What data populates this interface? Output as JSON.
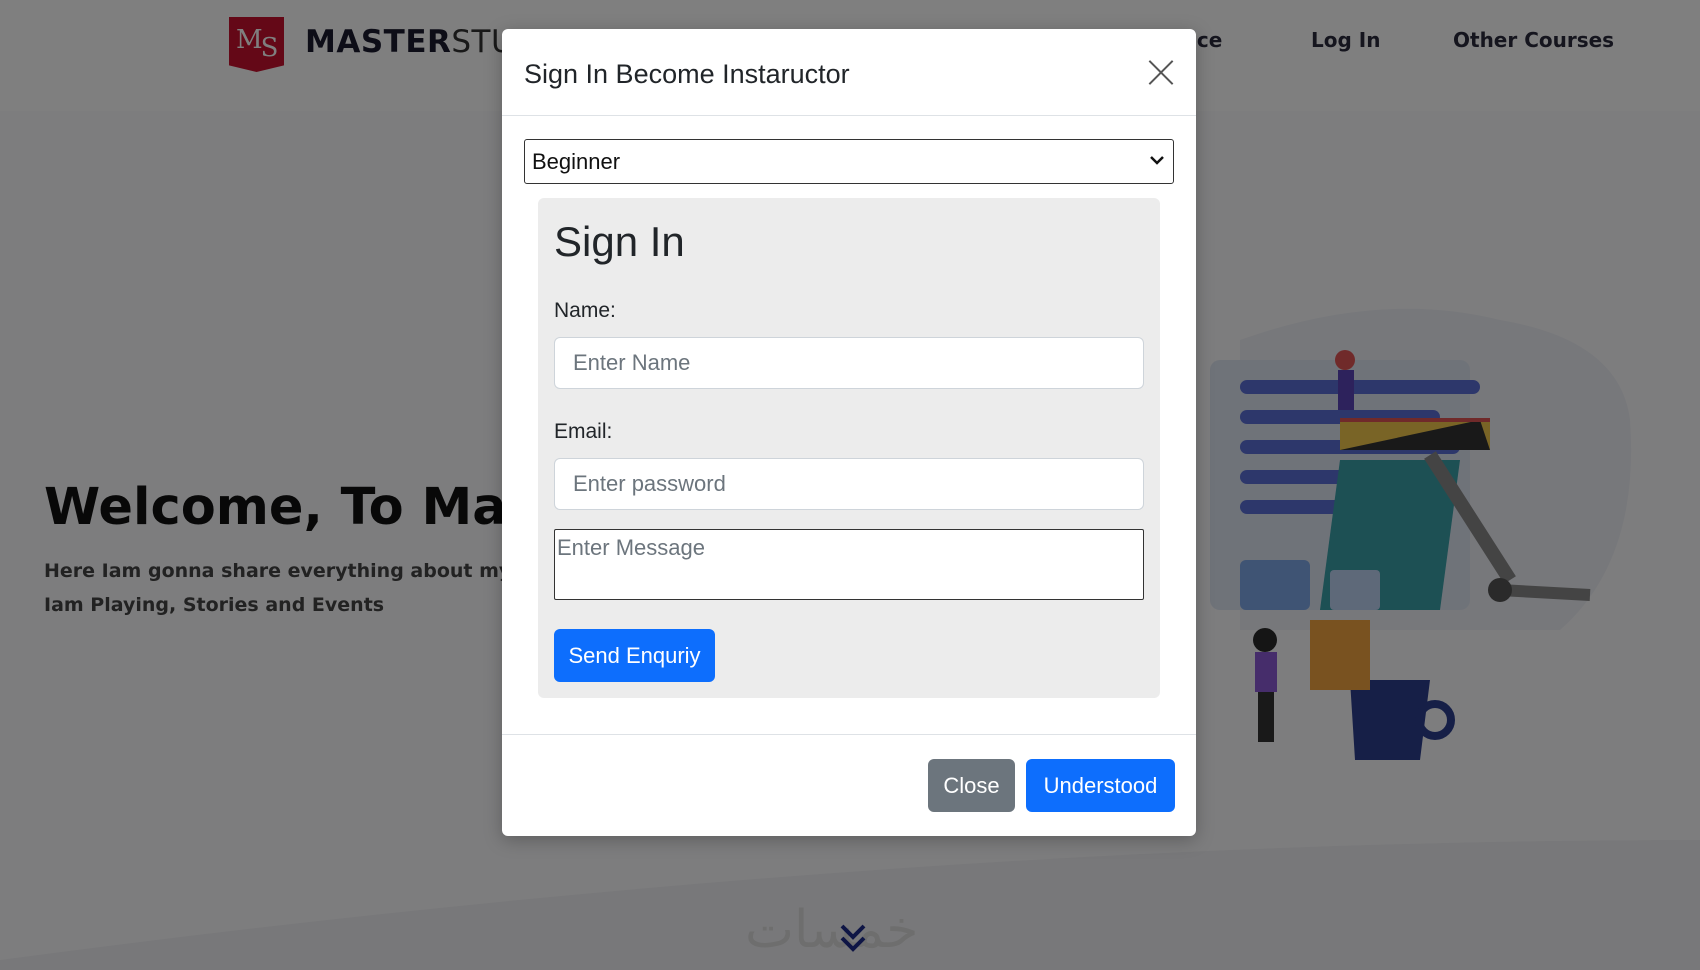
{
  "header": {
    "logo_letters_1": "M",
    "logo_letters_2": "S",
    "logo_bold": "MASTER",
    "logo_light": "STU",
    "nav": [
      {
        "label": "ice"
      },
      {
        "label": "Log In"
      },
      {
        "label": "Other Courses"
      }
    ]
  },
  "hero": {
    "title": "Welcome, To Mas",
    "line1": "Here Iam gonna share everything about my life.",
    "line2": "Iam Playing, Stories and Events"
  },
  "modal": {
    "title": "Sign In Become Instaructor",
    "close_icon": "close-icon",
    "level_select": {
      "selected": "Beginner"
    },
    "form": {
      "heading": "Sign In",
      "name_label": "Name:",
      "name_placeholder": "Enter Name",
      "email_label": "Email:",
      "email_placeholder": "Enter password",
      "message_placeholder": "Enter Message",
      "submit_label": "Send Enquriy"
    },
    "footer": {
      "close_label": "Close",
      "understood_label": "Understood"
    }
  },
  "watermark": "خمسات",
  "colors": {
    "primary": "#0d6efd",
    "secondary": "#6c757d",
    "brand": "#c8102e",
    "backdrop": "#000000"
  }
}
